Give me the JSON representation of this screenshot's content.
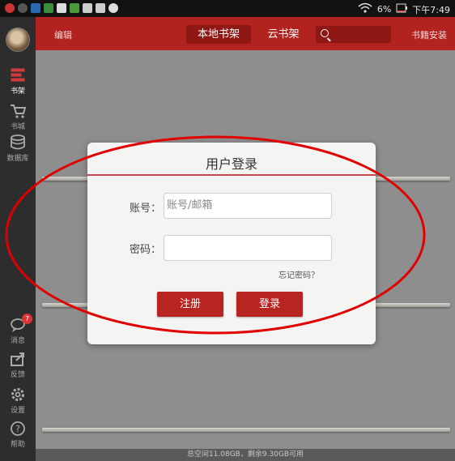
{
  "status_bar": {
    "battery": "6%",
    "time": "下午7:49",
    "icons": [
      "notification-icon",
      "wifi-icon",
      "battery-icon",
      "clock-icon"
    ]
  },
  "sidebar": {
    "items": [
      {
        "label": "书架",
        "icon": "bookshelf-icon",
        "active": true
      },
      {
        "label": "书城",
        "icon": "cart-icon"
      },
      {
        "label": "数据库",
        "icon": "database-icon"
      },
      {
        "label": "消息",
        "icon": "message-icon",
        "badge": "7"
      },
      {
        "label": "反馈",
        "icon": "feedback-icon"
      },
      {
        "label": "设置",
        "icon": "settings-icon"
      },
      {
        "label": "帮助",
        "icon": "help-icon"
      }
    ]
  },
  "topbar": {
    "edit_label": "编辑",
    "tabs": [
      {
        "label": "本地书架",
        "active": true
      },
      {
        "label": "云书架",
        "active": false
      }
    ],
    "install_label": "书籍安装"
  },
  "main": {
    "storage_info": "总空间11.08GB，剩余9.30GB可用"
  },
  "login_dialog": {
    "title": "用户登录",
    "account_label": "账号：",
    "account_placeholder": "账号/邮箱",
    "password_label": "密码：",
    "password_value": "",
    "forgot_label": "忘记密码？",
    "register_label": "注册",
    "login_label": "登录"
  },
  "colors": {
    "brand_red": "#b22320",
    "annotation_red": "#e00000"
  }
}
